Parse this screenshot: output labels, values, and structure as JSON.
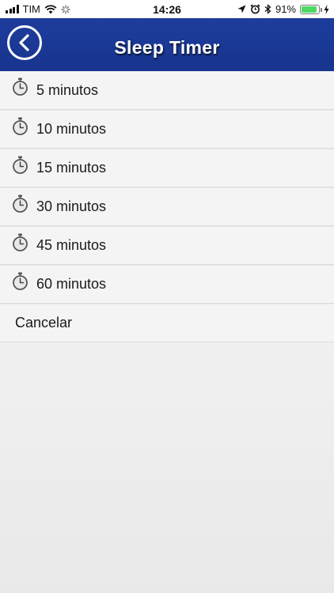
{
  "status_bar": {
    "carrier": "TIM",
    "time": "14:26",
    "battery_percent": "91%",
    "battery_level": 0.91,
    "icons": [
      "signal-icon",
      "wifi-icon",
      "activity-icon",
      "location-icon",
      "alarm-icon",
      "bluetooth-icon",
      "battery-icon",
      "charging-icon"
    ]
  },
  "header": {
    "title": "Sleep Timer",
    "back_icon": "back-chevron-icon"
  },
  "options": [
    {
      "label": "5 minutos",
      "icon": "stopwatch-icon"
    },
    {
      "label": "10 minutos",
      "icon": "stopwatch-icon"
    },
    {
      "label": "15 minutos",
      "icon": "stopwatch-icon"
    },
    {
      "label": "30 minutos",
      "icon": "stopwatch-icon"
    },
    {
      "label": "45 minutos",
      "icon": "stopwatch-icon"
    },
    {
      "label": "60 minutos",
      "icon": "stopwatch-icon"
    }
  ],
  "cancel_label": "Cancelar",
  "colors": {
    "header": "#1a3895",
    "battery": "#4cd964"
  }
}
